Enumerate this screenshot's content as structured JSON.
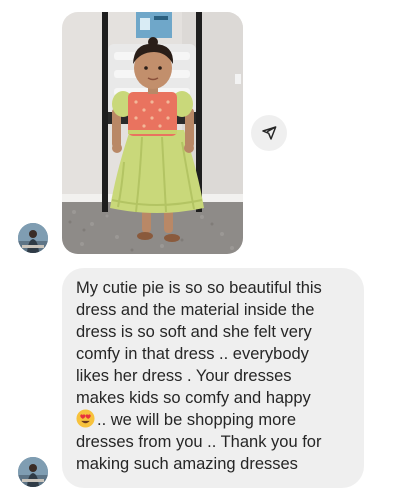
{
  "conversation": {
    "photo_message": {
      "image": "photo-of-toddler-in-green-dress",
      "share_icon": "paper-plane-icon"
    },
    "text_message": {
      "lines": [
        "My cutie pie is so so beautiful this",
        "dress and the material inside the",
        "dress is so soft and she felt very",
        "comfy in that dress .. everybody",
        "likes her dress . Your dresses",
        "makes kids so comfy and happy",
        ".. we will be shopping more",
        "dresses from you .. Thank you for",
        "making such amazing dresses"
      ],
      "emoji": "heart-eyes-emoji"
    },
    "sender_avatar": "profile-avatar"
  },
  "colors": {
    "bubble": "#efefef",
    "text": "#262626",
    "dress": "#c9d87a",
    "bodice": "#e9735f"
  }
}
